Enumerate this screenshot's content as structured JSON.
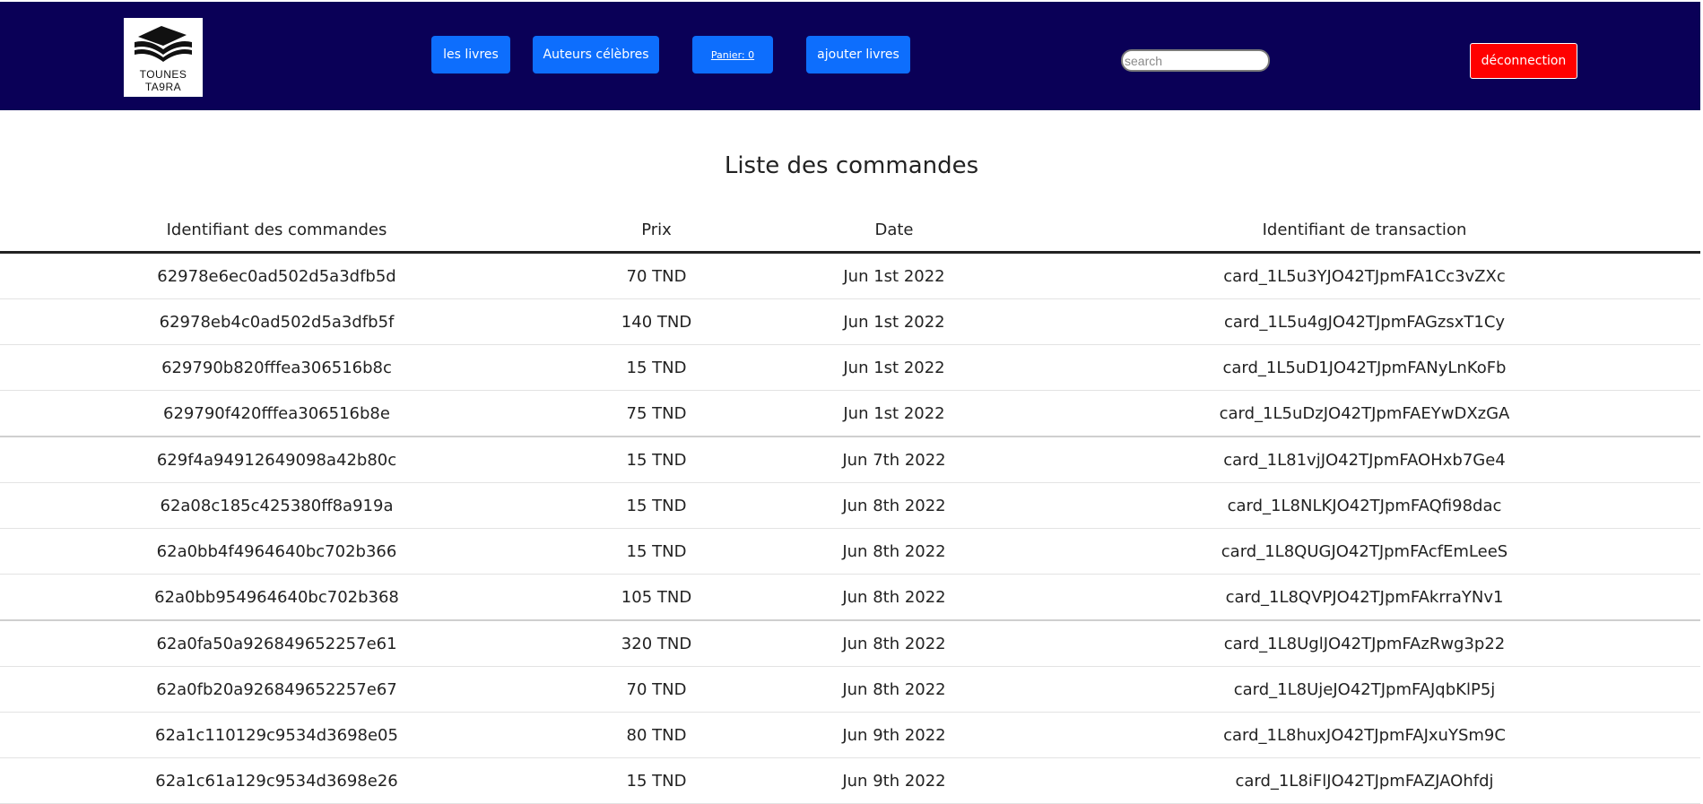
{
  "header": {
    "logo_text_line1": "TOUNES",
    "logo_text_line2": "TA9RA",
    "nav": {
      "livres": "les livres",
      "auteurs": "Auteurs célèbres",
      "panier": "Panier: 0",
      "ajouter": "ajouter livres"
    },
    "search_placeholder": "search",
    "logout": "déconnection"
  },
  "main": {
    "title": "Liste des commandes",
    "columns": [
      "Identifiant des commandes",
      "Prix",
      "Date",
      "Identifiant de transaction"
    ],
    "rows": [
      {
        "id": "62978e6ec0ad502d5a3dfb5d",
        "prix": "70 TND",
        "date": "Jun 1st 2022",
        "transaction": "card_1L5u3YJO42TJpmFA1Cc3vZXc"
      },
      {
        "id": "62978eb4c0ad502d5a3dfb5f",
        "prix": "140 TND",
        "date": "Jun 1st 2022",
        "transaction": "card_1L5u4gJO42TJpmFAGzsxT1Cy"
      },
      {
        "id": "629790b820fffea306516b8c",
        "prix": "15 TND",
        "date": "Jun 1st 2022",
        "transaction": "card_1L5uD1JO42TJpmFANyLnKoFb"
      },
      {
        "id": "629790f420fffea306516b8e",
        "prix": "75 TND",
        "date": "Jun 1st 2022",
        "transaction": "card_1L5uDzJO42TJpmFAEYwDXzGA"
      },
      {
        "id": "629f4a94912649098a42b80c",
        "prix": "15 TND",
        "date": "Jun 7th 2022",
        "transaction": "card_1L81vjJO42TJpmFAOHxb7Ge4"
      },
      {
        "id": "62a08c185c425380ff8a919a",
        "prix": "15 TND",
        "date": "Jun 8th 2022",
        "transaction": "card_1L8NLKJO42TJpmFAQfi98dac"
      },
      {
        "id": "62a0bb4f4964640bc702b366",
        "prix": "15 TND",
        "date": "Jun 8th 2022",
        "transaction": "card_1L8QUGJO42TJpmFAcfEmLeeS"
      },
      {
        "id": "62a0bb954964640bc702b368",
        "prix": "105 TND",
        "date": "Jun 8th 2022",
        "transaction": "card_1L8QVPJO42TJpmFAkrraYNv1"
      },
      {
        "id": "62a0fa50a926849652257e61",
        "prix": "320 TND",
        "date": "Jun 8th 2022",
        "transaction": "card_1L8UglJO42TJpmFAzRwg3p22"
      },
      {
        "id": "62a0fb20a926849652257e67",
        "prix": "70 TND",
        "date": "Jun 8th 2022",
        "transaction": "card_1L8UjeJO42TJpmFAJqbKlP5j"
      },
      {
        "id": "62a1c110129c9534d3698e05",
        "prix": "80 TND",
        "date": "Jun 9th 2022",
        "transaction": "card_1L8huxJO42TJpmFAJxuYSm9C"
      },
      {
        "id": "62a1c61a129c9534d3698e26",
        "prix": "15 TND",
        "date": "Jun 9th 2022",
        "transaction": "card_1L8iFlJO42TJpmFAZJAOhfdj"
      }
    ]
  },
  "colors": {
    "header_bg": "#0a0057",
    "nav_button": "#0d6efd",
    "logout_button": "#ff0000"
  }
}
